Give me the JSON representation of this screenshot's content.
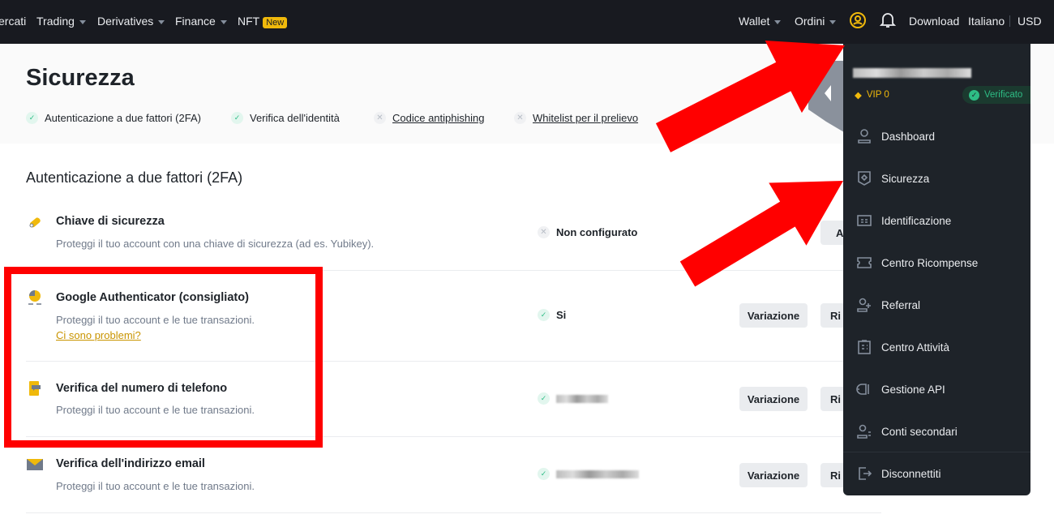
{
  "nav": {
    "items": [
      {
        "label": "ercati"
      },
      {
        "label": "Trading"
      },
      {
        "label": "Derivatives"
      },
      {
        "label": "Finance"
      },
      {
        "label": "NFT"
      }
    ],
    "new_badge": "New",
    "right": {
      "wallet": "Wallet",
      "orders": "Ordini",
      "download": "Download",
      "language": "Italiano",
      "currency": "USD"
    }
  },
  "page": {
    "title": "Sicurezza",
    "status_items": [
      {
        "label": "Autenticazione a due fattori (2FA)",
        "state": "ok"
      },
      {
        "label": "Verifica dell'identità",
        "state": "ok"
      },
      {
        "label": "Codice antiphishing",
        "state": "no"
      },
      {
        "label": "Whitelist per il prelievo",
        "state": "no"
      }
    ],
    "section_title": "Autenticazione a due fattori (2FA)",
    "rows": [
      {
        "title": "Chiave di sicurezza",
        "desc": "Proteggi il tuo account con una chiave di sicurezza (ad es. Yubikey).",
        "status": "Non configurato",
        "button1": "A"
      },
      {
        "title": "Google Authenticator (consigliato)",
        "desc": "Proteggi il tuo account e le tue transazioni.",
        "link": "Ci sono problemi?",
        "status": "Si",
        "button1": "Variazione",
        "button2": "Ri"
      },
      {
        "title": "Verifica del numero di telefono",
        "desc": "Proteggi il tuo account e le tue transazioni.",
        "button1": "Variazione",
        "button2": "Ri"
      },
      {
        "title": "Verifica dell'indirizzo email",
        "desc": "Proteggi il tuo account e le tue transazioni.",
        "button1": "Variazione",
        "button2": "Ri"
      }
    ]
  },
  "menu": {
    "vip": "VIP 0",
    "verified": "Verificato",
    "items": [
      {
        "label": "Dashboard",
        "icon": "user-icon"
      },
      {
        "label": "Sicurezza",
        "icon": "shield-icon"
      },
      {
        "label": "Identificazione",
        "icon": "id-card-icon"
      },
      {
        "label": "Centro Ricompense",
        "icon": "ticket-icon"
      },
      {
        "label": "Referral",
        "icon": "user-plus-icon"
      },
      {
        "label": "Centro Attività",
        "icon": "clipboard-icon"
      },
      {
        "label": "Gestione API",
        "icon": "api-icon"
      },
      {
        "label": "Conti secondari",
        "icon": "sub-accounts-icon"
      },
      {
        "label": "Disconnettiti",
        "icon": "logout-icon"
      }
    ]
  },
  "colors": {
    "accent": "#f0b90b",
    "nav_bg": "#181a20",
    "menu_bg": "#1e2329",
    "success": "#2ebd85",
    "annotation": "#ff0000"
  }
}
